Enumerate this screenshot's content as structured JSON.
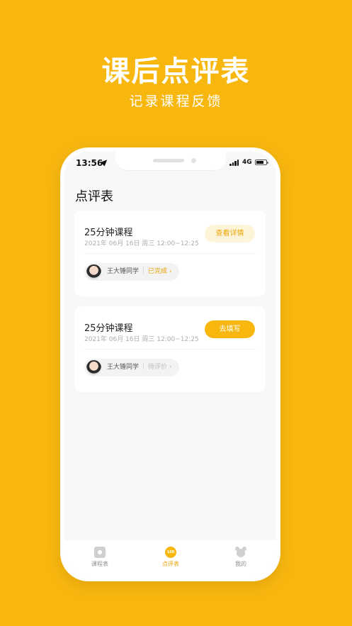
{
  "promo": {
    "title": "课后点评表",
    "subtitle": "记录课程反馈"
  },
  "status_bar": {
    "time": "13:56",
    "network": "4G"
  },
  "page": {
    "title": "点评表"
  },
  "cards": [
    {
      "title": "25分钟课程",
      "date": "2021年 06月 16日 周三 12:00~12:25",
      "button_label": "查看详情",
      "student": "王大锤同学",
      "status": "已完成"
    },
    {
      "title": "25分钟课程",
      "date": "2021年 06月 16日 周三 12:00~12:25",
      "button_label": "去填写",
      "student": "王大锤同学",
      "status": "待评价"
    }
  ],
  "tabbar": {
    "schedule": "课程表",
    "review": "点评表",
    "review_icon_text": "100",
    "mine": "我的"
  },
  "colors": {
    "brand": "#F7B70F",
    "accent_text": "#E9A60A"
  }
}
